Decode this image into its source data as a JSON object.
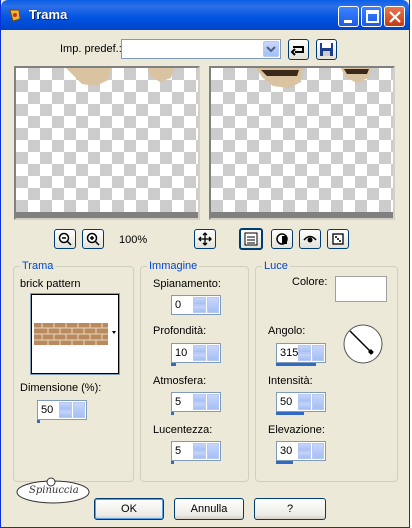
{
  "window": {
    "title": "Trama"
  },
  "preset": {
    "label": "Imp. predef.:",
    "value": ""
  },
  "zoom": {
    "level": "100%"
  },
  "trama": {
    "legend": "Trama",
    "pattern_name": "brick pattern",
    "dimension_label": "Dimensione (%):",
    "dimension_value": "50"
  },
  "immagine": {
    "legend": "Immagine",
    "spianamento_label": "Spianamento:",
    "spianamento_value": "0",
    "profondita_label": "Profondità:",
    "profondita_value": "10",
    "atmosfera_label": "Atmosfera:",
    "atmosfera_value": "5",
    "lucentezza_label": "Lucentezza:",
    "lucentezza_value": "5"
  },
  "luce": {
    "legend": "Luce",
    "colore_label": "Colore:",
    "angolo_label": "Angolo:",
    "angolo_value": "315",
    "intensita_label": "Intensità:",
    "intensita_value": "50",
    "elevazione_label": "Elevazione:",
    "elevazione_value": "30"
  },
  "footer": {
    "ok_label": "OK",
    "annulla_label": "Annulla",
    "help_label": "?",
    "watermark": "Spinuccia"
  },
  "colors": {
    "titlebar": "#0054e3",
    "legend": "#0046d5",
    "face": "#ece9d8"
  }
}
